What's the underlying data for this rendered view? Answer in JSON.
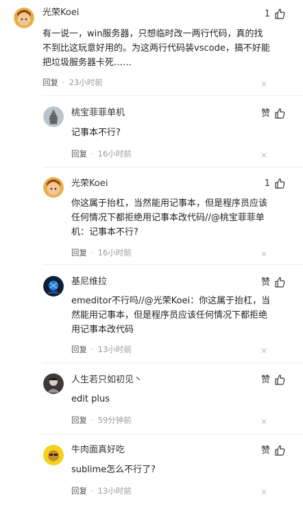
{
  "colors": {
    "text": "#222222",
    "meta": "#999999",
    "separator": "#eeeeee"
  },
  "comments": [
    {
      "user": "光荣Koei",
      "like_label": "1",
      "text": "有一说一，win服务器，只想临时改一两行代码，真的找不到比这玩意好用的。为这两行代码装vscode，搞不好能把垃圾服务器卡死……",
      "reply_label": "回复",
      "time": "23小时前",
      "close_glyph": "×",
      "thumb_icon": "thumb-up-icon"
    },
    {
      "user": "桃宝菲菲单机",
      "like_label": "赞",
      "text": "记事本不行?",
      "reply_label": "回复",
      "time": "16小时前",
      "close_glyph": "×",
      "thumb_icon": "thumb-up-icon"
    },
    {
      "user": "光荣Koei",
      "like_label": "1",
      "text": "你这属于抬杠，当然能用记事本，但是程序员应该任何情况下都拒绝用记事本改代码//@桃宝菲菲单机：记事本不行?",
      "reply_label": "回复",
      "time": "16小时前",
      "close_glyph": "×",
      "thumb_icon": "thumb-up-icon"
    },
    {
      "user": "基尼维拉",
      "like_label": "赞",
      "text": "emeditor不行吗//@光荣Koei：你这属于抬杠，当然能用记事本，但是程序员应该任何情况下都拒绝用记事本改代码",
      "reply_label": "回复",
      "time": "13小时前",
      "close_glyph": "×",
      "thumb_icon": "thumb-up-icon"
    },
    {
      "user": "人生若只如初见丶",
      "like_label": "赞",
      "text": "edit plus",
      "reply_label": "回复",
      "time": "59分钟前",
      "close_glyph": "×",
      "thumb_icon": "thumb-up-icon"
    },
    {
      "user": "牛肉面真好吃",
      "like_label": "赞",
      "text": "sublime怎么不行了?",
      "reply_label": "回复",
      "time": "13小时前",
      "close_glyph": "×",
      "thumb_icon": "thumb-up-icon"
    }
  ]
}
